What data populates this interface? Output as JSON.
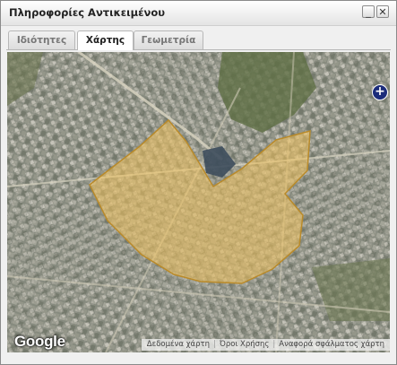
{
  "window": {
    "title": "Πληροφορίες Αντικειμένου",
    "minimize_glyph": "_",
    "close_glyph": "✕"
  },
  "tabs": [
    {
      "label": "Ιδιότητες",
      "active": false
    },
    {
      "label": "Χάρτης",
      "active": true
    },
    {
      "label": "Γεωμετρία",
      "active": false
    }
  ],
  "map": {
    "logo_text": "Google",
    "zoom_in_glyph": "+",
    "attribution": {
      "map_data": "Δεδομένα χάρτη",
      "terms": "Όροι Χρήσης",
      "report_error": "Αναφορά σφάλματος χάρτη"
    },
    "polygon_fill_color": "#f2c25c",
    "polygon_stroke_color": "#b98a2a"
  }
}
